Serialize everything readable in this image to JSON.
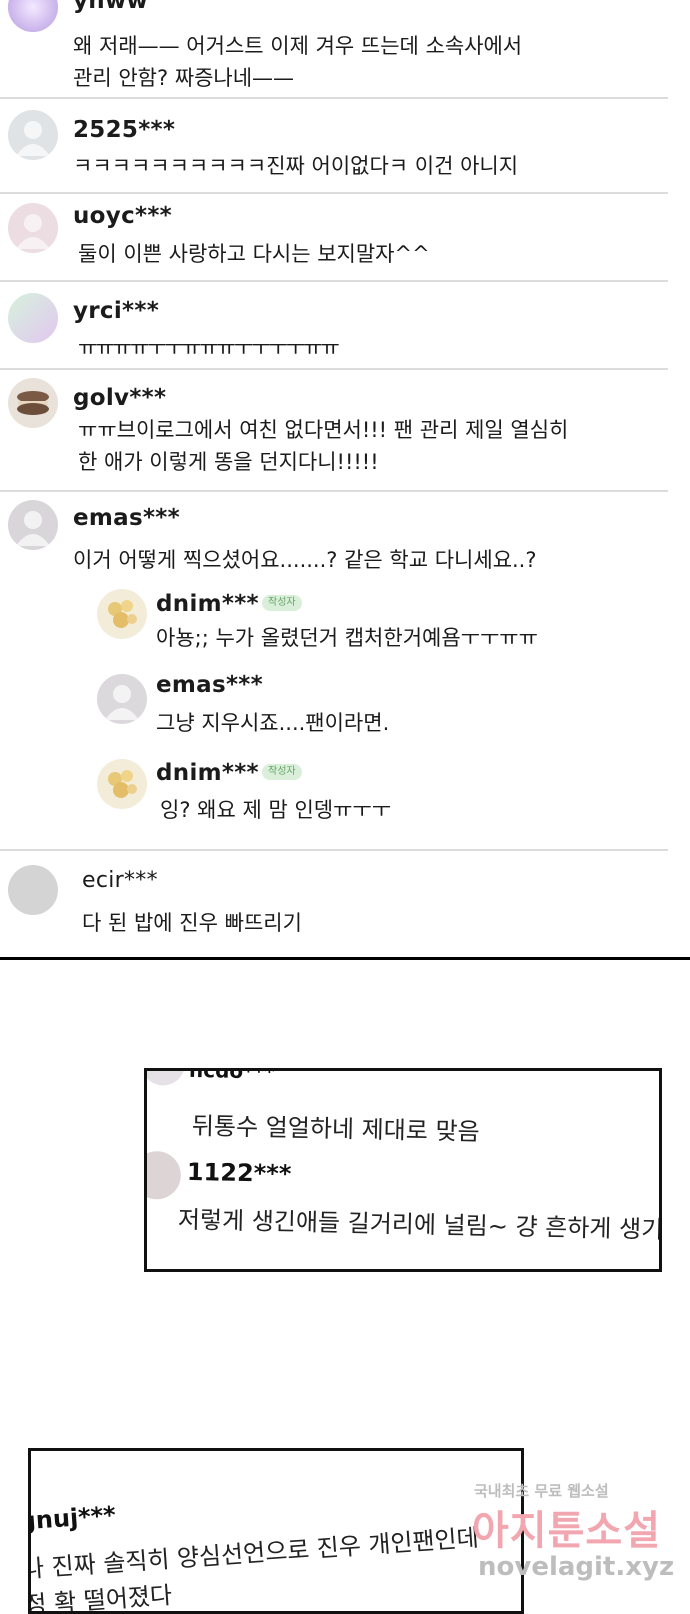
{
  "comments": [
    {
      "user": "yhww",
      "lines": [
        "왜 저래—— 어거스트 이제 겨우 뜨는데 소속사에서",
        "관리 안함? 짜증나네——"
      ]
    },
    {
      "user": "2525***",
      "lines": [
        "ㅋㅋㅋㅋㅋㅋㅋㅋㅋㅋ진짜 어이없다ㅋ 이건 아니지"
      ]
    },
    {
      "user": "uoyc***",
      "lines": [
        "둘이 이쁜 사랑하고 다시는 보지말자^^"
      ]
    },
    {
      "user": "yrci***",
      "lines": [
        "ㅠㅠㅠㅠㅜㅜㅠㅠㅠㅜㅜㅜㅜㅠㅠ"
      ]
    },
    {
      "user": "golv***",
      "lines": [
        "ㅠㅠ브이로그에서 여친 없다면서!!! 팬 관리 제일 열심히",
        "한 애가 이렇게 똥을 던지다니!!!!!"
      ]
    },
    {
      "user": "emas***",
      "lines": [
        "이거 어떻게 찍으셨어요.......? 같은 학교 다니세요..?"
      ]
    },
    {
      "user": "ecir***",
      "lines": [
        "다 된 밥에 진우 빠뜨리기"
      ]
    }
  ],
  "replies": [
    {
      "user": "dnim***",
      "badge": "작성자",
      "text": "아뇽;; 누가 올렸던거 캡처한거예욤ㅜㅜㅠㅠ"
    },
    {
      "user": "emas***",
      "badge": "",
      "text": "그냥 지우시죠....팬이라면."
    },
    {
      "user": "dnim***",
      "badge": "작성자",
      "text": "잉? 왜요 제 맘 인뎅ㅠㅜㅜ"
    }
  ],
  "panel1": {
    "top_user_fragment": "ncdo***",
    "line1": "뒤통수 얼얼하네 제대로 맞음",
    "user2": "1122***",
    "line2": "저렇게 생긴애들 길거리에 널림~ 걍 흔하게 생기"
  },
  "panel2": {
    "user": "gnuj***",
    "line1": "나 진짜 솔직히 양심선언으로 진우 개인팬인데",
    "line2": "정 확 떨어졌다"
  },
  "watermark": {
    "small": "국내최초 무료 웹소설",
    "big": "아지툰소설",
    "site": "novelagit.xyz"
  },
  "colors": {
    "divider": "#dcdcdc",
    "badge_bg": "#d9efd9",
    "badge_text": "#6aa56a",
    "watermark_pink": "#f2a6b0"
  }
}
